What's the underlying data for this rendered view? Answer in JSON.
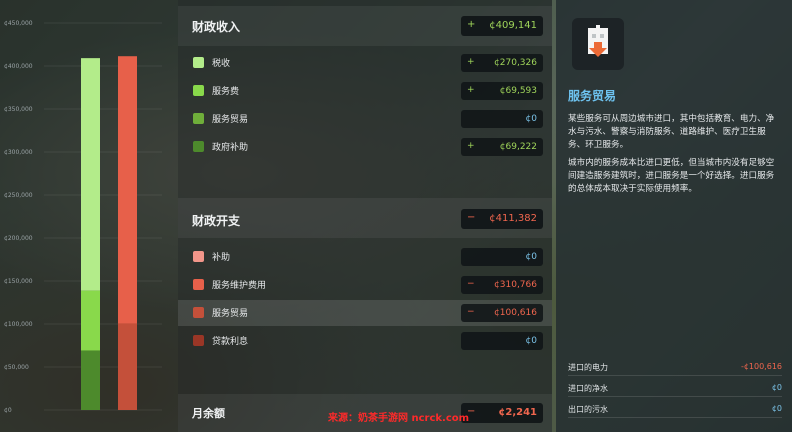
{
  "chart": {
    "y_ticks": [
      "¢450,000",
      "¢400,000",
      "¢350,000",
      "¢300,000",
      "¢250,000",
      "¢200,000",
      "¢150,000",
      "¢100,000",
      "¢50,000",
      "¢0"
    ],
    "ylim": [
      0,
      450000
    ],
    "income_bar": {
      "total": 409141,
      "segments": [
        {
          "name": "政府补助",
          "value": 69222,
          "color": "#4d8a2c"
        },
        {
          "name": "服务费",
          "value": 69593,
          "color": "#89d94b"
        },
        {
          "name": "税收",
          "value": 270326,
          "color": "#b3ec8a"
        }
      ]
    },
    "expense_bar": {
      "total": 411382,
      "segments": [
        {
          "name": "服务贸易",
          "value": 100616,
          "color": "#c4503a"
        },
        {
          "name": "服务维护费用",
          "value": 310766,
          "color": "#e7604a"
        }
      ]
    }
  },
  "income": {
    "title": "财政收入",
    "sign": "+",
    "total": "¢409,141",
    "rows": [
      {
        "label": "税收",
        "sign": "+",
        "value": "¢270,326",
        "color": "#b3ec8a",
        "tone": "pos"
      },
      {
        "label": "服务费",
        "sign": "+",
        "value": "¢69,593",
        "color": "#89d94b",
        "tone": "pos"
      },
      {
        "label": "服务贸易",
        "sign": "",
        "value": "¢0",
        "color": "#6fae3a",
        "tone": "zero"
      },
      {
        "label": "政府补助",
        "sign": "+",
        "value": "¢69,222",
        "color": "#4d8a2c",
        "tone": "pos"
      }
    ]
  },
  "expense": {
    "title": "财政开支",
    "sign": "−",
    "total": "¢411,382",
    "rows": [
      {
        "label": "补助",
        "sign": "",
        "value": "¢0",
        "color": "#f2968a",
        "tone": "zero"
      },
      {
        "label": "服务维护费用",
        "sign": "−",
        "value": "¢310,766",
        "color": "#e7604a",
        "tone": "neg"
      },
      {
        "label": "服务贸易",
        "sign": "−",
        "value": "¢100,616",
        "color": "#c4503a",
        "tone": "neg"
      },
      {
        "label": "贷款利息",
        "sign": "",
        "value": "¢0",
        "color": "#9a3626",
        "tone": "zero"
      }
    ]
  },
  "balance": {
    "label": "月余额",
    "sign": "−",
    "value": "¢2,241"
  },
  "detail": {
    "icon": "service-trade-icon",
    "title": "服务贸易",
    "desc1": "某些服务可从周边城市进口，其中包括教育、电力、净水与污水、警察与消防服务、道路维护、医疗卫生服务、环卫服务。",
    "desc2": "城市内的服务成本比进口更低，但当城市内没有足够空间建造服务建筑时，进口服务是一个好选择。进口服务的总体成本取决于实际使用频率。",
    "stats": [
      {
        "label": "进口的电力",
        "value": "-¢100,616",
        "tone": "neg"
      },
      {
        "label": "进口的净水",
        "value": "¢0",
        "tone": "zero"
      },
      {
        "label": "出口的污水",
        "value": "¢0",
        "tone": "zero"
      }
    ]
  },
  "watermark": "来源：奶茶手游网 ncrck.com"
}
